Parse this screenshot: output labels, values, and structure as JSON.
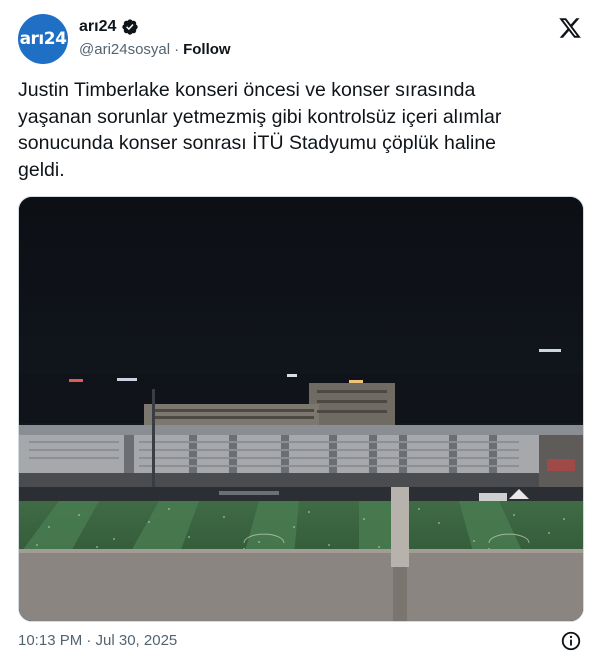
{
  "account": {
    "display_name": "arı24",
    "handle": "@ari24sosyal",
    "separator": "·",
    "follow_label": "Follow",
    "avatar_text": "arı24"
  },
  "tweet": {
    "text": "Justin Timberlake konseri öncesi ve konser sırasında\nyaşanan sorunlar yetmezmiş gibi kontrolsüz içeri alımlar\nsonucunda konser sonrası İTÜ Stadyumu çöplük haline\ngeldi."
  },
  "footer": {
    "timestamp": "10:13 PM · Jul 30, 2025"
  },
  "icons": {
    "verified": "verified-badge-icon",
    "platform": "x-logo-icon",
    "info": "info-icon"
  },
  "colors": {
    "avatar_bg": "#1f6fc4",
    "text": "#0f1419",
    "muted": "#536471"
  }
}
